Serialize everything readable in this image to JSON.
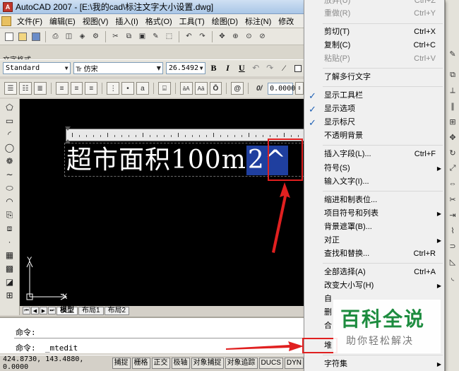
{
  "window": {
    "title": "AutoCAD 2007 - [E:\\我的cad\\标注文字大小设置.dwg]"
  },
  "menubar": {
    "items": [
      "文件(F)",
      "编辑(E)",
      "视图(V)",
      "插入(I)",
      "格式(O)",
      "工具(T)",
      "绘图(D)",
      "标注(N)",
      "修改"
    ]
  },
  "text_format": {
    "title": "文字格式",
    "style": "Standard",
    "font": "仿宋",
    "font_prefix": "Tr",
    "height": "26.5492",
    "bold": "B",
    "italic": "I",
    "underline": "U",
    "overline": "Ō",
    "oblique_label": "0/",
    "oblique_value": "0.0000",
    "case_upper": "āA",
    "case_lower": "Aā",
    "symbol": "@"
  },
  "editor": {
    "text_main": "超市面积100m",
    "text_selected": "2^"
  },
  "ucs": {
    "x": "X",
    "y": "Y"
  },
  "tabs": {
    "model": "模型",
    "layout1": "布局1",
    "layout2": "布局2"
  },
  "command": {
    "line1": "命令:",
    "line2": "命令:  _mtedit"
  },
  "status": {
    "coords": "424.8730, 143.4880, 0.0000",
    "buttons": [
      "捕捉",
      "栅格",
      "正交",
      "极轴",
      "对象捕捉",
      "对象追踪",
      "DUCS",
      "DYN"
    ]
  },
  "context_menu": {
    "items": [
      {
        "label": "放弃(U)",
        "shortcut": "Ctrl+Z",
        "disabled": true
      },
      {
        "label": "重做(R)",
        "shortcut": "Ctrl+Y",
        "disabled": true
      },
      {
        "label": "剪切(T)",
        "shortcut": "Ctrl+X"
      },
      {
        "label": "复制(C)",
        "shortcut": "Ctrl+C"
      },
      {
        "label": "粘贴(P)",
        "shortcut": "Ctrl+V",
        "disabled": true
      },
      {
        "label": "了解多行文字"
      },
      {
        "label": "显示工具栏",
        "checked": true
      },
      {
        "label": "显示选项",
        "checked": true
      },
      {
        "label": "显示标尺",
        "checked": true
      },
      {
        "label": "不透明背景"
      },
      {
        "label": "插入字段(L)...",
        "shortcut": "Ctrl+F"
      },
      {
        "label": "符号(S)"
      },
      {
        "label": "输入文字(I)..."
      },
      {
        "label": "缩进和制表位..."
      },
      {
        "label": "项目符号和列表"
      },
      {
        "label": "背景遮罩(B)..."
      },
      {
        "label": "对正"
      },
      {
        "label": "查找和替换...",
        "shortcut": "Ctrl+R"
      },
      {
        "label": "全部选择(A)",
        "shortcut": "Ctrl+A"
      },
      {
        "label": "改变大小写(H)"
      },
      {
        "label": "自"
      },
      {
        "label": "删"
      },
      {
        "label": "合"
      },
      {
        "label": "堆"
      },
      {
        "label": "字符集"
      }
    ]
  },
  "watermark": {
    "title": "百科全说",
    "subtitle": "助你轻松解决"
  },
  "colors": {
    "selection": "#1f3f9f",
    "annotation_red": "#e02020",
    "watermark_green": "#1d8c3f"
  }
}
